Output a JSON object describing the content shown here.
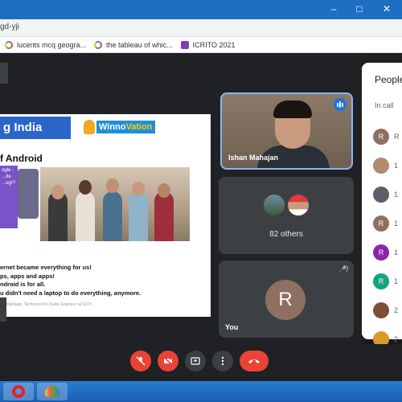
{
  "browser": {
    "url_fragment": "gd-yji",
    "bookmarks": [
      {
        "label": "lucents mcq geogra...",
        "icon": "google-icon"
      },
      {
        "label": "the tableau of whic...",
        "icon": "google-icon"
      },
      {
        "label": "ICRITO 2021",
        "icon": "icrito-icon"
      }
    ]
  },
  "slide": {
    "banner_text": "g India",
    "logo_text_a": "Winno",
    "logo_text_b": "Vation",
    "heading": "f Android",
    "purple_text": "ogle - ...de ...ogr?",
    "bullets": [
      "ernet became everything for us!",
      "ps, apps and apps!",
      "ndroid is for all.",
      "u didn't need a laptop to do everything, anymore."
    ],
    "footer": "Mahajan, Technical Pre-Sales Engineer at SOTI"
  },
  "tiles": {
    "speaker_name": "Ishan Mahajan",
    "others_label": "82 others",
    "you_initial": "R",
    "you_label": "You"
  },
  "people": {
    "title": "People",
    "in_call": "In call",
    "rows": [
      {
        "initial": "R",
        "text": "R",
        "color": "#8e6f62"
      },
      {
        "initial": "",
        "text": "1",
        "color": "#b38b6d"
      },
      {
        "initial": "",
        "text": "1",
        "color": "#5b6068"
      },
      {
        "initial": "R",
        "text": "1",
        "color": "#8e6f62"
      },
      {
        "initial": "R",
        "text": "1",
        "color": "#8e24aa"
      },
      {
        "initial": "R",
        "text": "1",
        "color": "#12a47c"
      },
      {
        "initial": "",
        "text": "2",
        "color": "#7a4f3a"
      },
      {
        "initial": "",
        "text": "2",
        "color": "#d99a2b"
      }
    ]
  },
  "controls": {
    "mic": "mic-off",
    "camera": "camera-off",
    "present": "present-screen",
    "more": "more-options",
    "hangup": "end-call"
  },
  "colors": {
    "meet_dark": "#202124",
    "tile_grey": "#3c4043",
    "danger_red": "#ea4335",
    "accent_blue": "#8ab4f8"
  }
}
